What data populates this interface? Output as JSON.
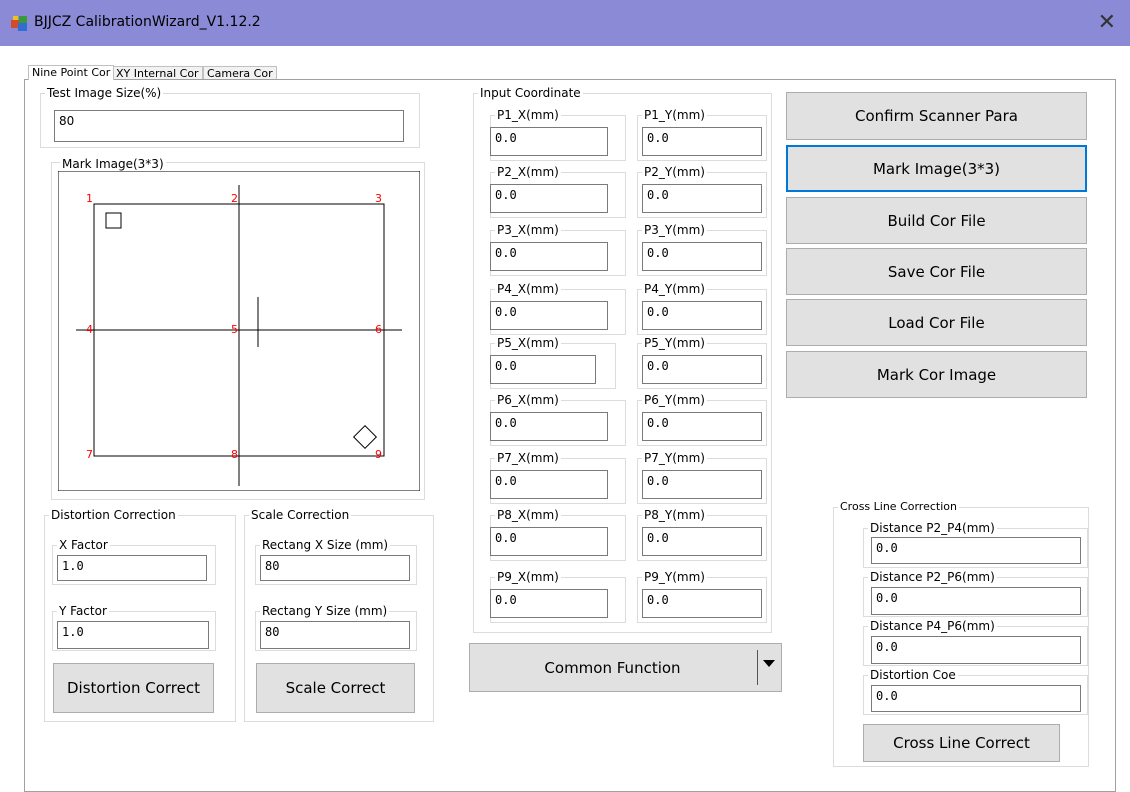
{
  "window": {
    "title": "BJJCZ CalibrationWizard_V1.12.2",
    "close_glyph": "✕"
  },
  "tabs": [
    {
      "label": "Nine Point Cor"
    },
    {
      "label": "XY Internal Cor"
    },
    {
      "label": "Camera Cor"
    }
  ],
  "test_image": {
    "legend": "Test Image Size(%)",
    "value": "80"
  },
  "mark_image": {
    "legend": "Mark Image(3*3)",
    "point_labels": [
      "1",
      "2",
      "3",
      "4",
      "5",
      "6",
      "7",
      "8",
      "9"
    ],
    "label_color": "#ff0000"
  },
  "distortion": {
    "legend": "Distortion Correction",
    "x_factor_label": "X Factor",
    "x_factor_value": "1.0",
    "y_factor_label": "Y Factor",
    "y_factor_value": "1.0",
    "button": "Distortion Correct"
  },
  "scale": {
    "legend": "Scale Correction",
    "x_size_label": "Rectang X Size (mm)",
    "x_size_value": "80",
    "y_size_label": "Rectang Y Size (mm)",
    "y_size_value": "80",
    "button": "Scale Correct"
  },
  "input_coordinate": {
    "legend": "Input Coordinate",
    "points": [
      {
        "x_label": "P1_X(mm)",
        "x_value": "0.0",
        "y_label": "P1_Y(mm)",
        "y_value": "0.0"
      },
      {
        "x_label": "P2_X(mm)",
        "x_value": "0.0",
        "y_label": "P2_Y(mm)",
        "y_value": "0.0"
      },
      {
        "x_label": "P3_X(mm)",
        "x_value": "0.0",
        "y_label": "P3_Y(mm)",
        "y_value": "0.0"
      },
      {
        "x_label": "P4_X(mm)",
        "x_value": "0.0",
        "y_label": "P4_Y(mm)",
        "y_value": "0.0"
      },
      {
        "x_label": "P5_X(mm)",
        "x_value": "0.0",
        "y_label": "P5_Y(mm)",
        "y_value": "0.0"
      },
      {
        "x_label": "P6_X(mm)",
        "x_value": "0.0",
        "y_label": "P6_Y(mm)",
        "y_value": "0.0"
      },
      {
        "x_label": "P7_X(mm)",
        "x_value": "0.0",
        "y_label": "P7_Y(mm)",
        "y_value": "0.0"
      },
      {
        "x_label": "P8_X(mm)",
        "x_value": "0.0",
        "y_label": "P8_Y(mm)",
        "y_value": "0.0"
      },
      {
        "x_label": "P9_X(mm)",
        "x_value": "0.0",
        "y_label": "P9_Y(mm)",
        "y_value": "0.0"
      }
    ]
  },
  "common_function": {
    "label": "Common Function",
    "arrow_icon": "dropdown-arrow-icon"
  },
  "actions": {
    "confirm_scanner_para": "Confirm Scanner Para",
    "mark_image": "Mark Image(3*3)",
    "build_cor_file": "Build Cor File",
    "save_cor_file": "Save Cor File",
    "load_cor_file": "Load Cor File",
    "mark_cor_image": "Mark Cor Image"
  },
  "cross_line": {
    "legend": "Cross Line Correction",
    "p2_p4_label": "Distance P2_P4(mm)",
    "p2_p4_value": "0.0",
    "p2_p6_label": "Distance P2_P6(mm)",
    "p2_p6_value": "0.0",
    "p4_p6_label": "Distance P4_P6(mm)",
    "p4_p6_value": "0.0",
    "coe_label": "Distortion Coe",
    "coe_value": "0.0",
    "button": "Cross Line Correct"
  },
  "colors": {
    "titlebar": "#8a8ad6",
    "button_face": "#e1e1e1",
    "focus_border": "#0078d7"
  }
}
